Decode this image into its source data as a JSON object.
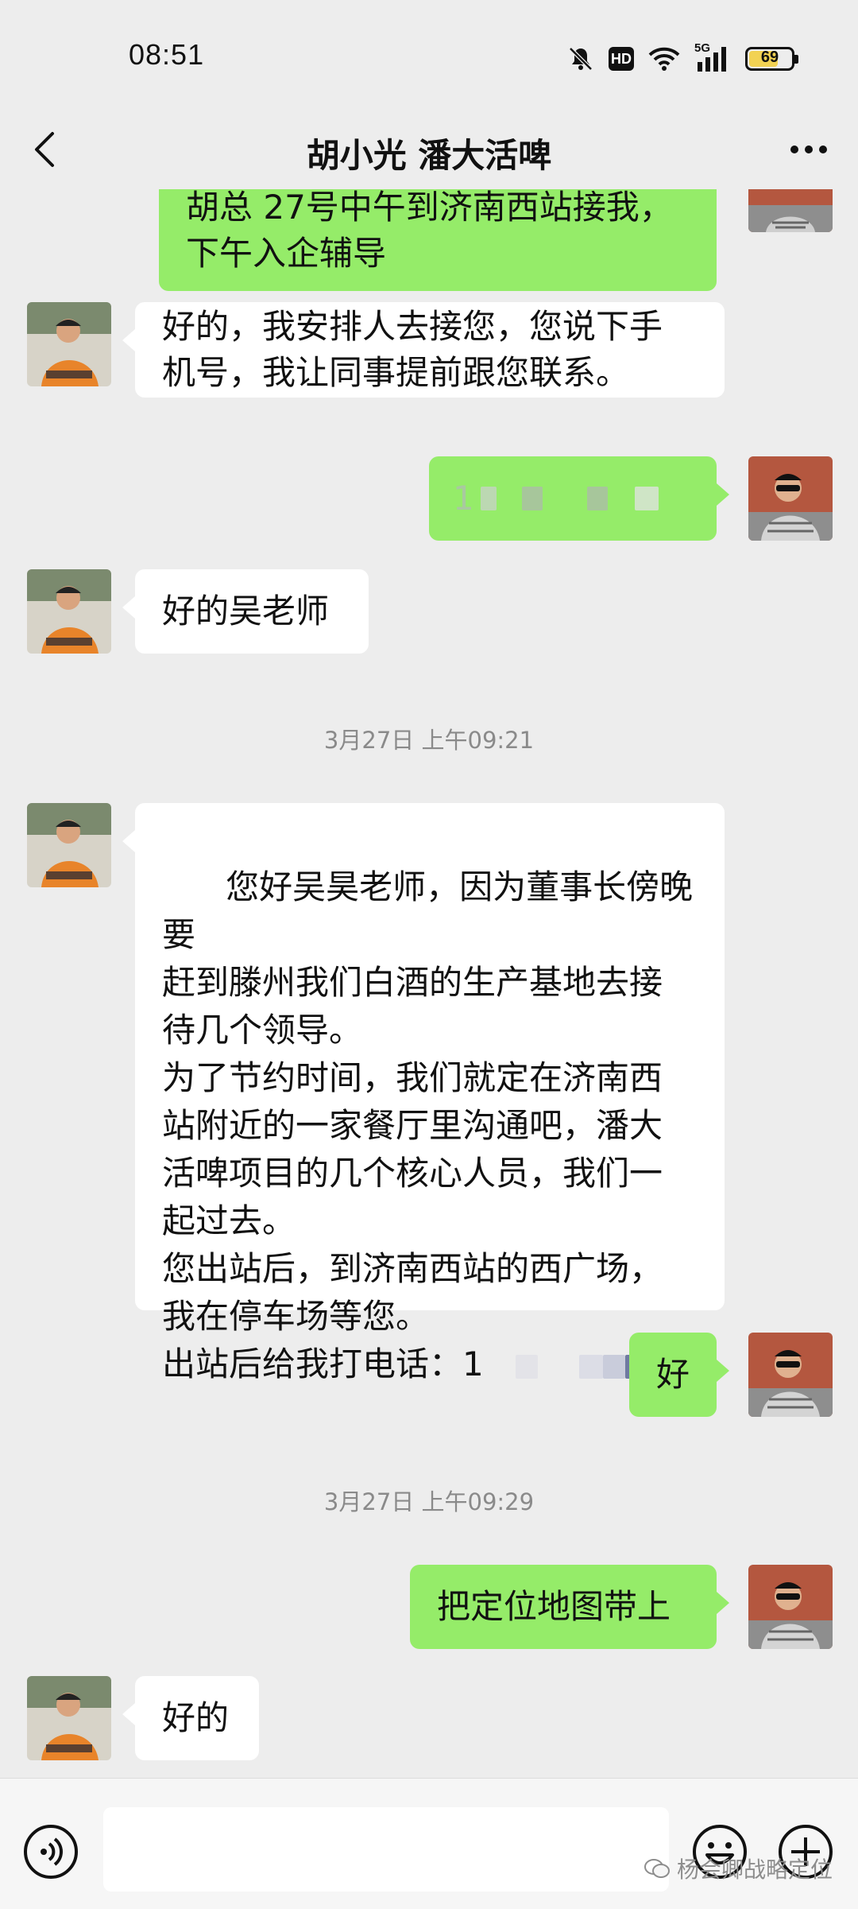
{
  "status_bar": {
    "time": "08:51",
    "hd": "HD",
    "network": "5G",
    "battery": "69",
    "battery_level": 0.69
  },
  "header": {
    "title": "胡小光  潘大活啤"
  },
  "messages": [
    {
      "side": "right",
      "text": "胡总 27号中午到济南西站接我，\n下午入企辅导"
    },
    {
      "side": "left",
      "text": "好的，我安排人去接您，您说下手\n机号，我让同事提前跟您联系。"
    },
    {
      "side": "right",
      "text": "1"
    },
    {
      "side": "left",
      "text": "好的吴老师"
    },
    {
      "timestamp": "3月27日 上午09:21"
    },
    {
      "side": "left",
      "text": "您好吴昊老师，因为董事长傍晚要\n赶到滕州我们白酒的生产基地去接\n待几个领导。\n为了节约时间，我们就定在济南西\n站附近的一家餐厅里沟通吧，潘大\n活啤项目的几个核心人员，我们一\n起过去。\n您出站后，到济南西站的西广场，\n我在停车场等您。\n出站后给我打电话：1"
    },
    {
      "side": "right",
      "text": "好"
    },
    {
      "timestamp": "3月27日 上午09:29"
    },
    {
      "side": "right",
      "text": "把定位地图带上"
    },
    {
      "side": "left",
      "text": "好的"
    }
  ],
  "watermark": "杨会卿战略定位",
  "colors": {
    "background": "#ededed",
    "sent_bubble": "#95ec69",
    "received_bubble": "#ffffff"
  }
}
